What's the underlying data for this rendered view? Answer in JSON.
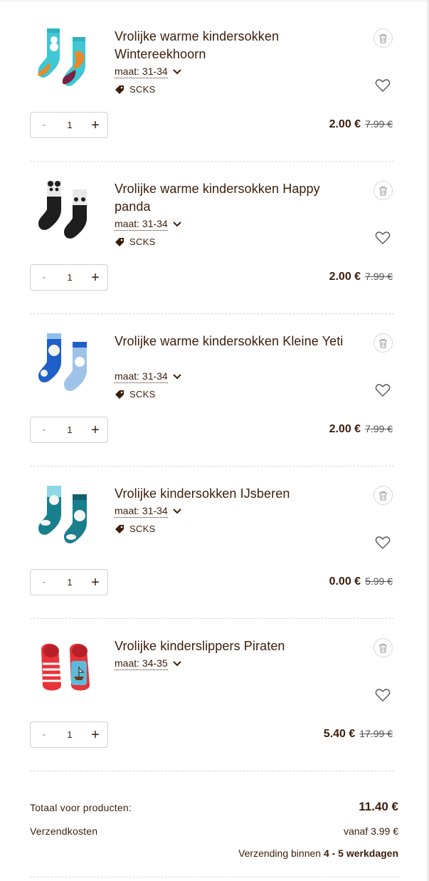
{
  "colors": {
    "text": "#3b1d0a",
    "border": "#cfcfcf",
    "separator": "#d8d8d8"
  },
  "items": [
    {
      "title": "Vrolijke warme kindersokken Wintereekhoorn",
      "size": "maat: 31-34",
      "tag": "SCKS",
      "qty_minus": "-",
      "qty": "1",
      "qty_plus": "+",
      "price": "2.00 €",
      "old_price": "7.99 €",
      "image": "sock-pair-squirrel"
    },
    {
      "title": "Vrolijke warme kindersokken Happy panda",
      "size": "maat: 31-34",
      "tag": "SCKS",
      "qty_minus": "-",
      "qty": "1",
      "qty_plus": "+",
      "price": "2.00 €",
      "old_price": "7.99 €",
      "image": "sock-pair-panda"
    },
    {
      "title": "Vrolijke warme kindersokken Kleine Yeti",
      "size": "maat: 31-34",
      "tag": "SCKS",
      "qty_minus": "-",
      "qty": "1",
      "qty_plus": "+",
      "price": "2.00 €",
      "old_price": "7.99 €",
      "image": "sock-pair-yeti"
    },
    {
      "title": "Vrolijke kindersokken IJsberen",
      "size": "maat: 31-34",
      "tag": "SCKS",
      "qty_minus": "-",
      "qty": "1",
      "qty_plus": "+",
      "price": "0.00 €",
      "old_price": "5.99 €",
      "image": "sock-pair-polar-bear"
    },
    {
      "title": "Vrolijke kinderslippers Piraten",
      "size": "maat: 34-35",
      "tag": "",
      "qty_minus": "-",
      "qty": "1",
      "qty_plus": "+",
      "price": "5.40 €",
      "old_price": "17.99 €",
      "image": "slipper-pair-pirate"
    }
  ],
  "summary": {
    "total_label": "Totaal voor producten:",
    "total_value": "11.40 €",
    "shipping_label": "Verzendkosten",
    "shipping_value": "vanaf 3.99 €",
    "delivery_prefix": "Verzending binnen",
    "delivery_days": "4 - 5 werkdagen"
  }
}
